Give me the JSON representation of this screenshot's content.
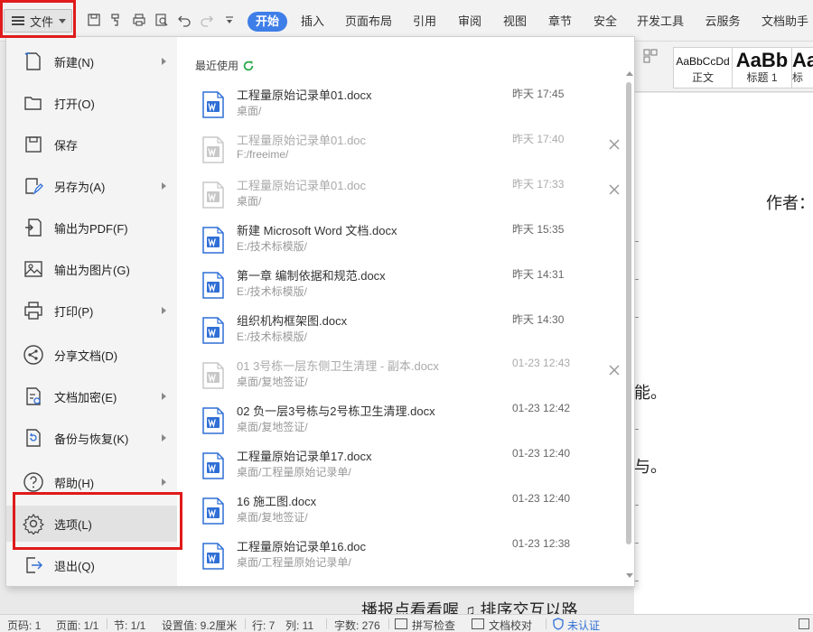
{
  "toolbar": {
    "file_label": "文件",
    "tabs": [
      "开始",
      "插入",
      "页面布局",
      "引用",
      "审阅",
      "视图",
      "章节",
      "安全",
      "开发工具",
      "云服务",
      "文档助手"
    ],
    "active_tab": "开始",
    "quick_access_icons": [
      "save-icon",
      "format-painter-icon",
      "print-icon",
      "print-preview-icon",
      "undo-icon",
      "redo-icon",
      "customize-icon"
    ]
  },
  "styles_gallery": [
    {
      "sample": "AaBbCcDd",
      "caption": "正文"
    },
    {
      "sample": "AaBb",
      "caption": "标题 1"
    },
    {
      "sample": "Aa",
      "caption": "标"
    }
  ],
  "file_menu": {
    "items": [
      {
        "label": "新建(N)",
        "icon": "new-file-icon",
        "submenu": true
      },
      {
        "label": "打开(O)",
        "icon": "open-folder-icon",
        "submenu": false
      },
      {
        "label": "保存",
        "icon": "save-icon",
        "submenu": false
      },
      {
        "label": "另存为(A)",
        "icon": "save-as-icon",
        "submenu": true
      },
      {
        "label": "输出为PDF(F)",
        "icon": "export-pdf-icon",
        "submenu": false
      },
      {
        "label": "输出为图片(G)",
        "icon": "export-image-icon",
        "submenu": false
      },
      {
        "label": "打印(P)",
        "icon": "print-icon",
        "submenu": true
      },
      {
        "label": "分享文档(D)",
        "icon": "share-icon",
        "submenu": false
      },
      {
        "label": "文档加密(E)",
        "icon": "encrypt-icon",
        "submenu": true
      },
      {
        "label": "备份与恢复(K)",
        "icon": "backup-icon",
        "submenu": true
      },
      {
        "label": "帮助(H)",
        "icon": "help-icon",
        "submenu": true
      },
      {
        "label": "选项(L)",
        "icon": "gear-icon",
        "submenu": false,
        "highlighted": true
      },
      {
        "label": "退出(Q)",
        "icon": "exit-icon",
        "submenu": false
      }
    ]
  },
  "recent": {
    "heading": "最近使用",
    "files": [
      {
        "name": "工程量原始记录单01.docx",
        "path": "桌面/",
        "time": "昨天 17:45",
        "dim": false,
        "removable": false
      },
      {
        "name": "工程量原始记录单01.doc",
        "path": "F:/freeime/",
        "time": "昨天 17:40",
        "dim": true,
        "removable": true
      },
      {
        "name": "工程量原始记录单01.doc",
        "path": "桌面/",
        "time": "昨天 17:33",
        "dim": true,
        "removable": true
      },
      {
        "name": "新建 Microsoft Word 文档.docx",
        "path": "E:/技术标模版/",
        "time": "昨天 15:35",
        "dim": false,
        "removable": false
      },
      {
        "name": "第一章 编制依据和规范.docx",
        "path": "E:/技术标模版/",
        "time": "昨天 14:31",
        "dim": false,
        "removable": false
      },
      {
        "name": "组织机构框架图.docx",
        "path": "E:/技术标模版/",
        "time": "昨天 14:30",
        "dim": false,
        "removable": false
      },
      {
        "name": "01  3号栋一层东侧卫生清理 - 副本.docx",
        "path": "桌面/复地签证/",
        "time": "01-23 12:43",
        "dim": true,
        "removable": true
      },
      {
        "name": "02   负一层3号栋与2号栋卫生清理.docx",
        "path": "桌面/复地签证/",
        "time": "01-23 12:42",
        "dim": false,
        "removable": false
      },
      {
        "name": "工程量原始记录单17.docx",
        "path": "桌面/工程量原始记录单/",
        "time": "01-23 12:40",
        "dim": false,
        "removable": false
      },
      {
        "name": "16  施工图.docx",
        "path": "桌面/复地签证/",
        "time": "01-23 12:40",
        "dim": false,
        "removable": false
      },
      {
        "name": "工程量原始记录单16.doc",
        "path": "桌面/工程量原始记录单/",
        "time": "01-23 12:38",
        "dim": false,
        "removable": false
      }
    ]
  },
  "document": {
    "author_label": "作者：",
    "line_a": "能。",
    "line_b": "与。",
    "bottom_line": "播报点看看喔 ♫ 排序交互以路"
  },
  "statusbar": {
    "page_num": "页码: 1",
    "page_count": "页面: 1/1",
    "section": "节: 1/1",
    "setting": "设置值: 9.2厘米",
    "row": "行: 7",
    "col": "列: 11",
    "word_count": "字数: 276",
    "spell_check": "拼写检查",
    "doc_proof": "文档校对",
    "cert": "未认证"
  },
  "colors": {
    "accent": "#3e7ee8",
    "highlight_box": "#e01a1a",
    "word_icon": "#2f6fd6"
  }
}
